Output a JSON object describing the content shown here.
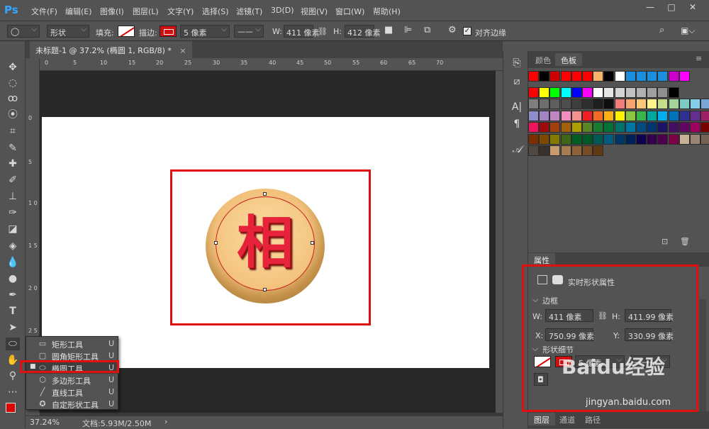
{
  "menubar": {
    "logo": "Ps",
    "items": [
      "文件(F)",
      "编辑(E)",
      "图像(I)",
      "图层(L)",
      "文字(Y)",
      "选择(S)",
      "滤镜(T)",
      "3D(D)",
      "视图(V)",
      "窗口(W)",
      "帮助(H)"
    ],
    "min": "—",
    "max": "□",
    "close": "✕"
  },
  "options": {
    "mode": "形状",
    "fill_label": "填充:",
    "stroke_label": "描边:",
    "stroke_width": "5 像素",
    "w_label": "W:",
    "w_value": "411 像素",
    "h_label": "H:",
    "h_value": "412 像素",
    "align_edges": "对齐边缘"
  },
  "document": {
    "tab_title": "未标题-1 @ 37.2% (椭圆 1, RGB/8) *",
    "tab_close": "×",
    "character": "相",
    "ruler_top": [
      "0",
      "5",
      "10",
      "15",
      "20",
      "25",
      "30",
      "35",
      "40",
      "45",
      "50",
      "55",
      "60",
      "65",
      "70"
    ],
    "ruler_left": [
      "0",
      "5",
      "1 0",
      "1 5",
      "2 0",
      "2 5"
    ]
  },
  "status": {
    "zoom": "37.24%",
    "doc_info": "文档:5.93M/2.50M",
    "arrow": "›"
  },
  "flyout": {
    "items": [
      {
        "icon": "rect",
        "label": "矩形工具",
        "key": "U"
      },
      {
        "icon": "rounded-rect",
        "label": "圆角矩形工具",
        "key": "U"
      },
      {
        "icon": "ellipse",
        "label": "椭圆工具",
        "key": "U",
        "active": true
      },
      {
        "icon": "polygon",
        "label": "多边形工具",
        "key": "U"
      },
      {
        "icon": "line",
        "label": "直线工具",
        "key": "U"
      },
      {
        "icon": "custom-shape",
        "label": "自定形状工具",
        "key": "U"
      }
    ]
  },
  "panels": {
    "tab_color": "颜色",
    "tab_swatches": "色板",
    "tab_properties": "属性",
    "tab_layers": "图层",
    "tab_channels": "通道",
    "tab_paths": "路径"
  },
  "properties": {
    "title": "实时形状属性",
    "section_border": "边框",
    "w_label": "W:",
    "w_value": "411 像素",
    "h_label": "H:",
    "h_value": "411.99 像素",
    "x_label": "X:",
    "x_value": "750.99 像素",
    "y_label": "Y:",
    "y_value": "330.99 像素",
    "section_shape": "形状细节",
    "stroke_width": "5 像素"
  },
  "watermark": {
    "text": "Baidu经验",
    "url": "jingyan.baidu.com"
  },
  "colors": {
    "accent_red": "#e01010",
    "bg": "#535353",
    "canvas_bg": "#282828"
  },
  "swatch_rows": [
    [
      "#ff0000",
      "#000000",
      "#cc0000",
      "#ff0000",
      "#ff0000",
      "#ff0000",
      "#f9b46b",
      "#000000",
      "#ffffff",
      "#1a8fe0",
      "#1a8fe0",
      "#1a8fe0",
      "#1a8fe0",
      "#cc00cc",
      "#ff00ff"
    ],
    [
      "#ff0000",
      "#ffff00",
      "#00ff00",
      "#00ffff",
      "#0000ff",
      "#ff00ff",
      "#ffffff",
      "#e6e6e6",
      "#d4d4d4",
      "#c2c2c2",
      "#b1b1b1",
      "#a0a0a0",
      "#8f8f8f",
      "#000000"
    ],
    [
      "#7e7e7e",
      "#6e6e6e",
      "#5e5e5e",
      "#4e4e4e",
      "#3e3e3e",
      "#2e2e2e",
      "#1e1e1e",
      "#0e0e0e",
      "#f27b7b",
      "#f7a56f",
      "#fbc979",
      "#fff58c",
      "#c4df8a",
      "#a3d49c",
      "#7ccbc4",
      "#83ccea",
      "#7aa6d7"
    ],
    [
      "#8c8dc9",
      "#a184c1",
      "#bf87c2",
      "#f08fbe",
      "#f2918f",
      "#ef1f24",
      "#f36c24",
      "#fbaf17",
      "#fff200",
      "#8cc63f",
      "#39b54a",
      "#00a79d",
      "#00aeef",
      "#0072bc",
      "#2e3192",
      "#662d91",
      "#9e1f63"
    ],
    [
      "#ed145b",
      "#9e0b0f",
      "#a0410d",
      "#a3620a",
      "#aba000",
      "#598527",
      "#197b30",
      "#007236",
      "#00746b",
      "#0076a3",
      "#004a80",
      "#003471",
      "#1b1464",
      "#440e62",
      "#630460",
      "#9e005d",
      "#790000"
    ],
    [
      "#7b2e00",
      "#7d4900",
      "#827b00",
      "#406618",
      "#005e20",
      "#005826",
      "#005952",
      "#005b7f",
      "#003663",
      "#002157",
      "#0d004c",
      "#32004b",
      "#4b0049",
      "#7b0046",
      "#c7b299",
      "#998675",
      "#736357"
    ],
    [
      "#534741",
      "#37302d",
      "#c69c6d",
      "#a67c52",
      "#8c6239",
      "#754c24",
      "#603913"
    ]
  ]
}
